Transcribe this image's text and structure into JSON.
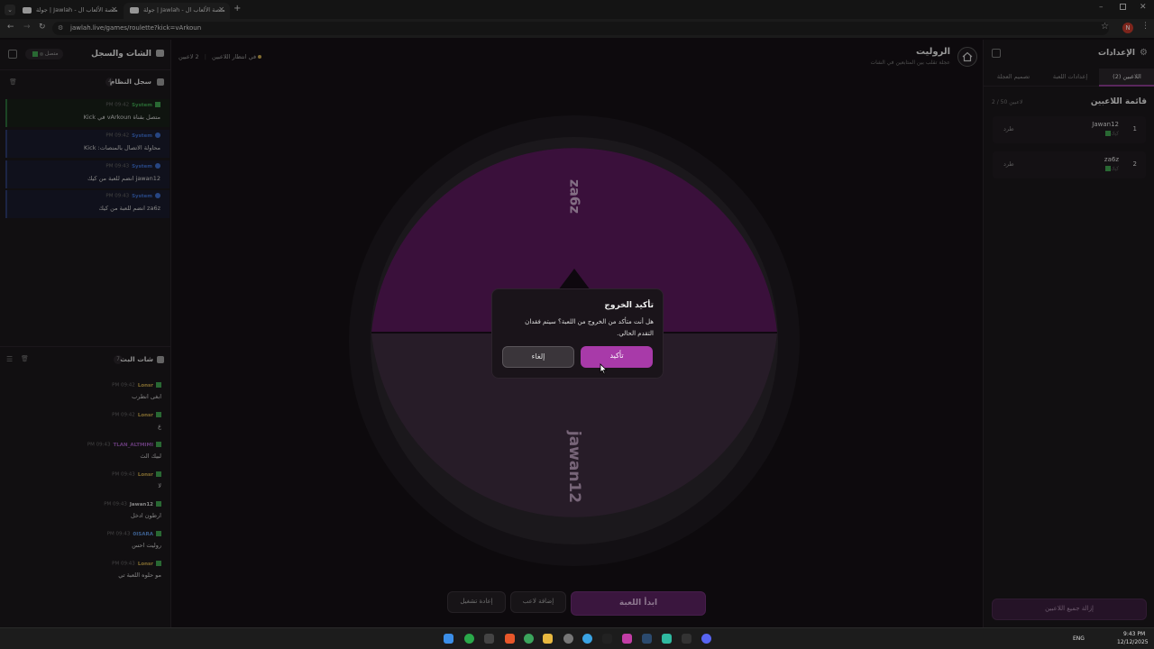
{
  "browser": {
    "tabs": [
      {
        "title": "جولة | Jawlah - منصة الألعاب ال"
      },
      {
        "title": "جولة | Jawlah - منصة الألعاب ال"
      }
    ],
    "url": "jawlah.live/games/roulette?kick=vArkoun",
    "profile_initial": "N"
  },
  "left": {
    "title": "الشات والسجل",
    "status": "متصل",
    "system_log": {
      "title": "سجل النظام",
      "count": "4",
      "entries": [
        {
          "time": "PM 09:42",
          "source": "System",
          "message": "متصل بقناة vArkoun في Kick"
        },
        {
          "time": "PM 09:42",
          "source": "System",
          "message": "محاولة الاتصال بالمنصات: Kick"
        },
        {
          "time": "PM 09:43",
          "source": "System",
          "message": "jawan12 انضم للعبة من كيك"
        },
        {
          "time": "PM 09:43",
          "source": "System",
          "message": "za6z انضم للعبة من كيك"
        }
      ]
    },
    "live_chat": {
      "title": "شات البث",
      "count": "7",
      "messages": [
        {
          "time": "PM 09:42",
          "user": "Lonsr",
          "color": "#c8a64a",
          "text": "ابغى انطرب"
        },
        {
          "time": "PM 09:42",
          "user": "Lonsr",
          "color": "#c8a64a",
          "text": "ع"
        },
        {
          "time": "PM 09:43",
          "user": "TLAN_ALTMIMI",
          "color": "#9b59b6",
          "text": "لبيك الث"
        },
        {
          "time": "PM 09:43",
          "user": "Lonsr",
          "color": "#c8a64a",
          "text": "لا"
        },
        {
          "time": "PM 09:43",
          "user": "Jawan12",
          "color": "#cfcfcf",
          "text": "ارطون ادخل"
        },
        {
          "time": "PM 09:43",
          "user": "0ISARA",
          "color": "#5b8fd6",
          "text": "روليت احس"
        },
        {
          "time": "PM 09:43",
          "user": "Lonsr",
          "color": "#c8a64a",
          "text": "مو حلوه اللعبة تي"
        }
      ]
    }
  },
  "center": {
    "title": "الروليت",
    "subtitle": "عجلة تقلب بين المتابعين في الشات",
    "players_count": "2 لاعبين",
    "waiting": "في انتظار اللاعبين",
    "wheel": {
      "segments": [
        "za6z",
        "jawan12"
      ],
      "colors": [
        "#591a5b",
        "#3d2b3e"
      ]
    },
    "buttons": {
      "start": "ابدأ اللعبة",
      "add_player": "إضافة لاعب",
      "restart": "إعادة تشغيل"
    }
  },
  "right": {
    "title": "الإعدادات",
    "tabs": [
      "اللاعبين (2)",
      "إعدادات اللعبة",
      "تصميم العجلة"
    ],
    "list_title": "قائمة اللاعبين",
    "list_count": "2 / 50 لاعبين",
    "players": [
      {
        "num": "1",
        "name": "Jawan12",
        "platform": "كيك",
        "kick": "طرد"
      },
      {
        "num": "2",
        "name": "za6z",
        "platform": "كيك",
        "kick": "طرد"
      }
    ],
    "remove_all": "إزالة جميع اللاعبين"
  },
  "modal": {
    "title": "تأكيد الخروج",
    "message_line1": "هل أنت متأكد من الخروج من اللعبة؟ سيتم فقدان",
    "message_line2": "التقدم الحالي.",
    "confirm": "تأكيد",
    "cancel": "إلغاء"
  },
  "taskbar": {
    "lang": "ENG",
    "time": "9:43 PM",
    "date": "12/12/2025"
  }
}
